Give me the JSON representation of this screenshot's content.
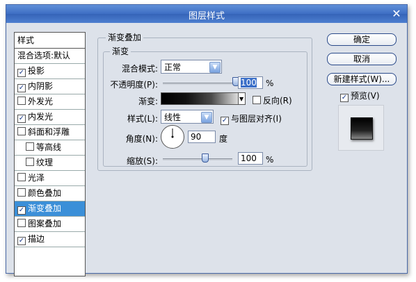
{
  "window": {
    "title": "图层样式",
    "close_glyph": "✕"
  },
  "sidebar": {
    "header": "样式",
    "items": [
      {
        "label": "混合选项:默认",
        "checkbox": false,
        "checked": false,
        "indent": false,
        "selected": false
      },
      {
        "label": "投影",
        "checkbox": true,
        "checked": true,
        "indent": false,
        "selected": false
      },
      {
        "label": "内阴影",
        "checkbox": true,
        "checked": true,
        "indent": false,
        "selected": false
      },
      {
        "label": "外发光",
        "checkbox": true,
        "checked": false,
        "indent": false,
        "selected": false
      },
      {
        "label": "内发光",
        "checkbox": true,
        "checked": true,
        "indent": false,
        "selected": false
      },
      {
        "label": "斜面和浮雕",
        "checkbox": true,
        "checked": false,
        "indent": false,
        "selected": false
      },
      {
        "label": "等高线",
        "checkbox": true,
        "checked": false,
        "indent": true,
        "selected": false
      },
      {
        "label": "纹理",
        "checkbox": true,
        "checked": false,
        "indent": true,
        "selected": false
      },
      {
        "label": "光泽",
        "checkbox": true,
        "checked": false,
        "indent": false,
        "selected": false
      },
      {
        "label": "颜色叠加",
        "checkbox": true,
        "checked": false,
        "indent": false,
        "selected": false
      },
      {
        "label": "渐变叠加",
        "checkbox": true,
        "checked": true,
        "indent": false,
        "selected": true
      },
      {
        "label": "图案叠加",
        "checkbox": true,
        "checked": false,
        "indent": false,
        "selected": false
      },
      {
        "label": "描边",
        "checkbox": true,
        "checked": true,
        "indent": false,
        "selected": false
      }
    ]
  },
  "panel": {
    "outer_title": "渐变叠加",
    "inner_title": "渐变",
    "blend_mode": {
      "label": "混合模式:",
      "value": "正常"
    },
    "opacity": {
      "label": "不透明度(P):",
      "value": "100",
      "unit": "%",
      "level": 1.0
    },
    "gradient": {
      "label": "渐变:",
      "reverse_label": "反向(R)",
      "reverse_checked": false
    },
    "style": {
      "label": "样式(L):",
      "value": "线性",
      "align_label": "与图层对齐(I)",
      "align_checked": true
    },
    "angle": {
      "label": "角度(N):",
      "value": "90",
      "unit": "度"
    },
    "scale": {
      "label": "缩放(S):",
      "value": "100",
      "unit": "%",
      "level": 0.6
    }
  },
  "buttons": {
    "ok": "确定",
    "cancel": "取消",
    "new_style": "新建样式(W)...",
    "preview_label": "预览(V)",
    "preview_checked": true
  },
  "check_glyph": "✓",
  "arrow_glyph": "▼"
}
